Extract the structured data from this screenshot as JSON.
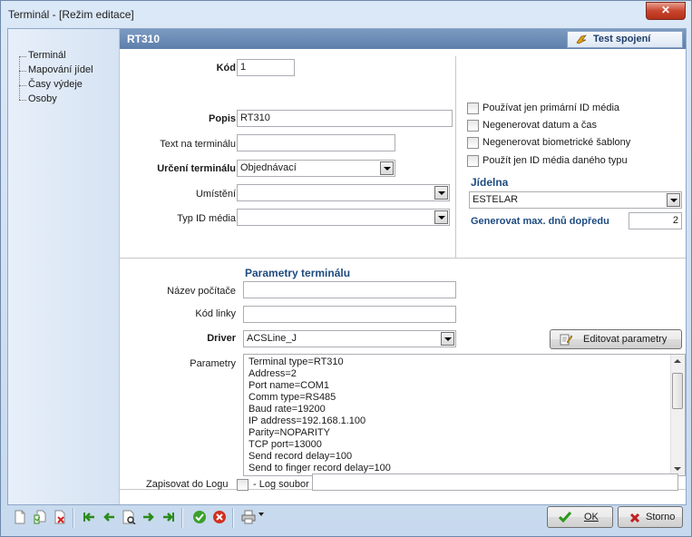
{
  "window": {
    "title": "Terminál - [Režim editace]",
    "close_label": "✕"
  },
  "nav": {
    "items": [
      "Terminál",
      "Mapování jídel",
      "Časy výdeje",
      "Osoby"
    ]
  },
  "header": {
    "title": "RT310",
    "test_button": "Test spojení"
  },
  "form": {
    "kod_label": "Kód",
    "kod_value": "1",
    "popis_label": "Popis",
    "popis_value": "RT310",
    "text_label": "Text na terminálu",
    "text_value": "",
    "urceni_label": "Určení terminálu",
    "urceni_value": "Objednávací",
    "umisteni_label": "Umístění",
    "umisteni_value": "",
    "typ_label": "Typ ID média",
    "typ_value": ""
  },
  "options": {
    "checkboxes": [
      "Používat jen primární ID média",
      "Negenerovat datum a čas",
      "Negenerovat biometrické šablony",
      "Použít jen ID média daného typu"
    ],
    "jidelna_title": "Jídelna",
    "jidelna_value": "ESTELAR",
    "generovat_label": "Generovat max. dnů dopředu",
    "generovat_value": "2"
  },
  "params": {
    "section_title": "Parametry terminálu",
    "nazev_label": "Název počítače",
    "nazev_value": "",
    "kod_linky_label": "Kód linky",
    "kod_linky_value": "",
    "driver_label": "Driver",
    "driver_value": "ACSLine_J",
    "edit_button": "Editovat parametry",
    "parametry_label": "Parametry",
    "lines": [
      "Terminal type=RT310",
      "Address=2",
      "Port name=COM1",
      "Comm type=RS485",
      "Baud rate=19200",
      "IP address=192.168.1.100",
      "Parity=NOPARITY",
      "TCP port=13000",
      "Send record delay=100",
      "Send to finger record delay=100"
    ]
  },
  "log": {
    "label": "Zapisovat do Logu",
    "checkbox_label": "- Log soubor",
    "value": ""
  },
  "footer": {
    "ok_label": "OK",
    "storno_label": "Storno"
  }
}
